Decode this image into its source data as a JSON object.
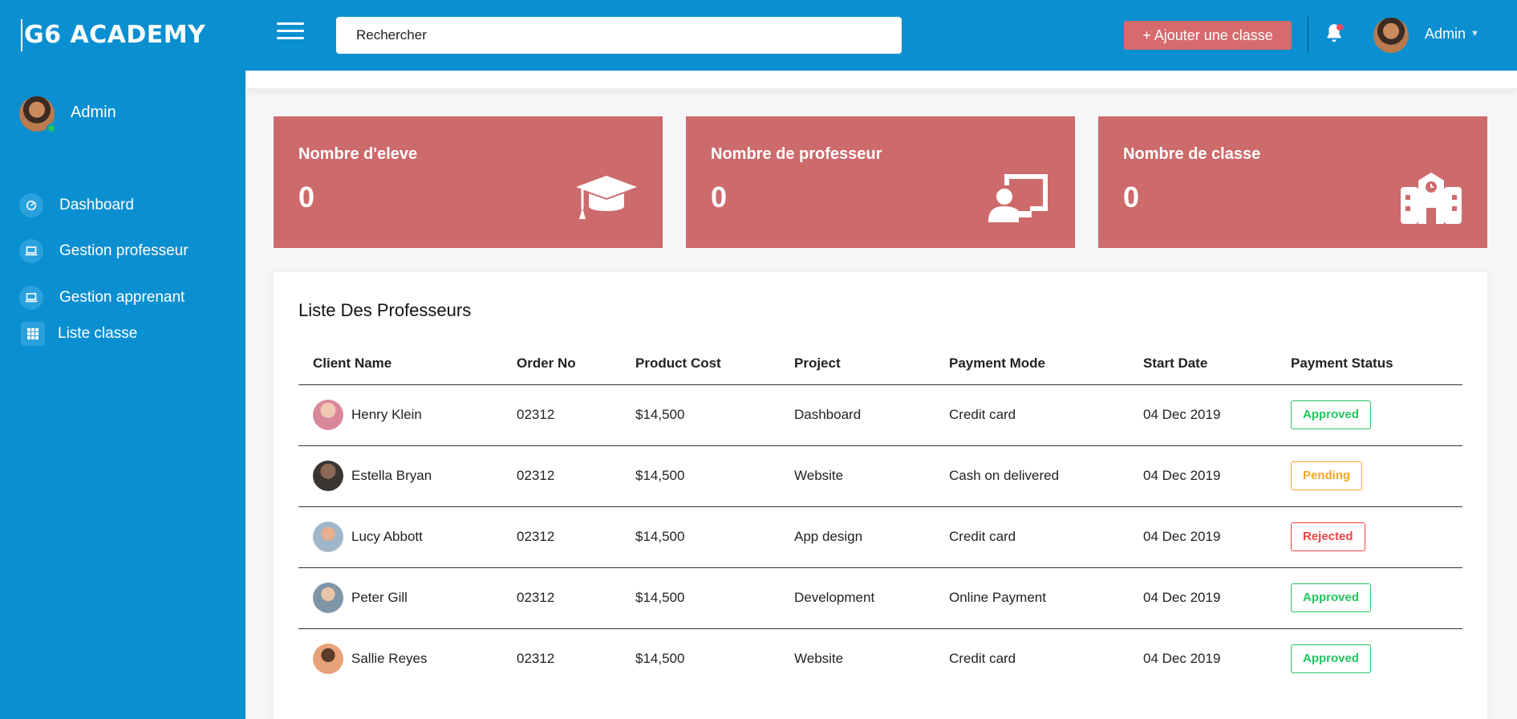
{
  "brand": "G6 ACADEMY",
  "header": {
    "search_placeholder": "Rechercher",
    "add_class_label": "+ Ajouter une classe",
    "user_name": "Admin",
    "icons": [
      "menu-icon",
      "bell-icon",
      "caret-down-icon"
    ],
    "accent": "#0a8fd1"
  },
  "sidebar": {
    "user_name": "Admin",
    "items": [
      {
        "label": "Dashboard",
        "icon": "gauge-icon"
      },
      {
        "label": "Gestion professeur",
        "icon": "laptop-icon"
      },
      {
        "label": "Gestion apprenant",
        "icon": "laptop-icon"
      },
      {
        "label": "Liste classe",
        "icon": "grid-icon"
      }
    ]
  },
  "stats": [
    {
      "label": "Nombre d'eleve",
      "value": "0",
      "icon": "graduation-cap-icon"
    },
    {
      "label": "Nombre de professeur",
      "value": "0",
      "icon": "teacher-board-icon"
    },
    {
      "label": "Nombre de classe",
      "value": "0",
      "icon": "school-icon"
    }
  ],
  "table": {
    "title": "Liste Des Professeurs",
    "columns": [
      "Client Name",
      "Order No",
      "Product Cost",
      "Project",
      "Payment Mode",
      "Start Date",
      "Payment Status"
    ],
    "rows": [
      {
        "name": "Henry Klein",
        "order": "02312",
        "cost": "$14,500",
        "project": "Dashboard",
        "mode": "Credit card",
        "date": "04 Dec 2019",
        "status": "Approved",
        "status_class": "approved",
        "avatar_color": "#d9889a"
      },
      {
        "name": "Estella Bryan",
        "order": "02312",
        "cost": "$14,500",
        "project": "Website",
        "mode": "Cash on delivered",
        "date": "04 Dec 2019",
        "status": "Pending",
        "status_class": "pending",
        "avatar_color": "#3a3530"
      },
      {
        "name": "Lucy Abbott",
        "order": "02312",
        "cost": "$14,500",
        "project": "App design",
        "mode": "Credit card",
        "date": "04 Dec 2019",
        "status": "Rejected",
        "status_class": "rejected",
        "avatar_color": "#9fb6c9"
      },
      {
        "name": "Peter Gill",
        "order": "02312",
        "cost": "$14,500",
        "project": "Development",
        "mode": "Online Payment",
        "date": "04 Dec 2019",
        "status": "Approved",
        "status_class": "approved",
        "avatar_color": "#7f95a8"
      },
      {
        "name": "Sallie Reyes",
        "order": "02312",
        "cost": "$14,500",
        "project": "Website",
        "mode": "Credit card",
        "date": "04 Dec 2019",
        "status": "Approved",
        "status_class": "approved",
        "avatar_color": "#e8a27a"
      }
    ]
  }
}
